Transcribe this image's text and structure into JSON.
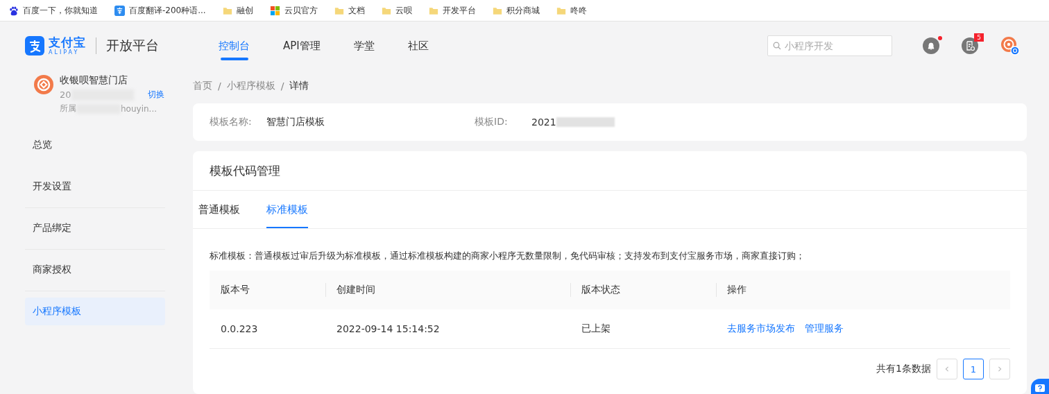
{
  "bookmarks": [
    {
      "label": "百度一下，你就知道",
      "kind": "paw"
    },
    {
      "label": "百度翻译-200种语...",
      "kind": "translate"
    },
    {
      "label": "融创",
      "kind": "folder"
    },
    {
      "label": "云贝官方",
      "kind": "tiles"
    },
    {
      "label": "文档",
      "kind": "folder"
    },
    {
      "label": "云呗",
      "kind": "folder"
    },
    {
      "label": "开发平台",
      "kind": "folder"
    },
    {
      "label": "积分商城",
      "kind": "folder"
    },
    {
      "label": "咚咚",
      "kind": "folder"
    }
  ],
  "brand": {
    "name": "支付宝",
    "sub": "ALIPAY",
    "product": "开放平台"
  },
  "nav": [
    {
      "label": "控制台",
      "selected": true
    },
    {
      "label": "API管理",
      "selected": false
    },
    {
      "label": "学堂",
      "selected": false
    },
    {
      "label": "社区",
      "selected": false
    }
  ],
  "search": {
    "placeholder": "小程序开发"
  },
  "messages": {
    "badge": "5"
  },
  "account": {
    "name": "收银呗智慧门店",
    "id_prefix": "20",
    "switch": "切换",
    "owner_prefix": "所属",
    "owner_suffix": "houyin..."
  },
  "sidebar": [
    {
      "label": "总览",
      "selected": false
    },
    {
      "label": "开发设置",
      "selected": false
    },
    {
      "label": "产品绑定",
      "selected": false
    },
    {
      "label": "商家授权",
      "selected": false
    },
    {
      "label": "小程序模板",
      "selected": true
    }
  ],
  "breadcrumb": {
    "items": [
      "首页",
      "小程序模板",
      "详情"
    ],
    "separator": "/"
  },
  "info": [
    {
      "label": "模板名称:",
      "value": "智慧门店模板",
      "blurred": false
    },
    {
      "label": "模板ID:",
      "value": "2021",
      "blurred": true
    }
  ],
  "section": {
    "title": "模板代码管理",
    "tabs": [
      {
        "label": "普通模板",
        "selected": false
      },
      {
        "label": "标准模板",
        "selected": true
      }
    ],
    "description": "标准模板：普通模板过审后升级为标准模板，通过标准模板构建的商家小程序无数量限制，免代码审核；支持发布到支付宝服务市场，商家直接订购；",
    "table": {
      "columns": [
        "版本号",
        "创建时间",
        "版本状态",
        "操作"
      ],
      "rows": [
        {
          "cells": [
            "0.0.223",
            "2022-09-14 15:14:52",
            "已上架"
          ],
          "actions": [
            "去服务市场发布",
            "管理服务"
          ]
        }
      ]
    },
    "pagination": {
      "total": "共有1条数据",
      "pages": [
        {
          "label": "1",
          "selected": true
        }
      ]
    }
  }
}
